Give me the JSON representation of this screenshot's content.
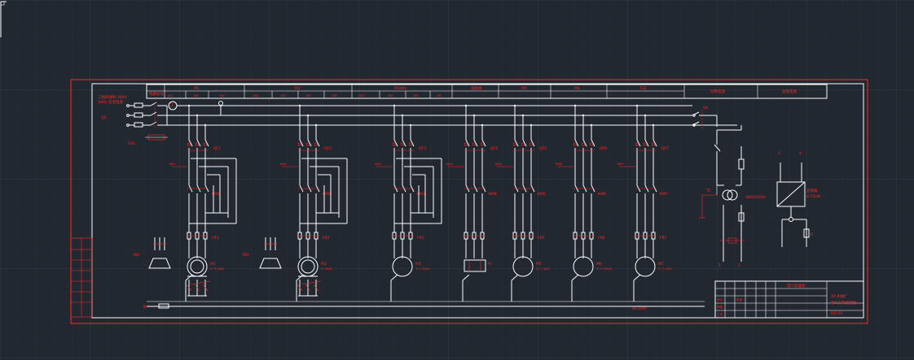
{
  "theme": {
    "background": "#212830",
    "grid_minor": "#2a323c",
    "grid_major": "#333c47",
    "frame_color": "#ff2a2a",
    "line_color": "#ffffff",
    "text_color": "#ff2a2a"
  },
  "header": {
    "left_cell": "线路标号",
    "cells": [
      "M1",
      "M2",
      "M3/M4",
      "电磁阀",
      "M5",
      "M6",
      "TS2"
    ],
    "sub_cells": [
      "QS1",
      "KM",
      "KM",
      "QS2",
      "KM",
      "KM",
      "KM",
      "QS3",
      "KM",
      "KM",
      "KM"
    ],
    "right_cells": [
      "控制电源",
      "变频电源"
    ]
  },
  "incoming": {
    "note_line1": "三相四线制 380V",
    "note_line2": "50Hz 交流电源",
    "phases": [
      "L1",
      "L2",
      "L3"
    ],
    "fuse_label": "FU1",
    "switch_label": "QS"
  },
  "columns": [
    {
      "id": "m1",
      "breaker": "QF1",
      "contactor": "KM1",
      "relay": "FR1",
      "motor": "M1",
      "motor_note": "3~5.5kW"
    },
    {
      "id": "m2",
      "breaker": "QF2",
      "contactor": "KM2",
      "relay": "FR2",
      "motor": "M2",
      "motor_note": "3~4kW"
    },
    {
      "id": "m3",
      "breaker": "QF3",
      "contactor": "KM3",
      "relay": "FR3",
      "motor": "M3",
      "motor_note": "3~2.2kW"
    },
    {
      "id": "valve",
      "breaker": "QF4",
      "contactor": "KM4",
      "relay": "",
      "motor": "YV",
      "motor_note": ""
    },
    {
      "id": "m5",
      "breaker": "QF5",
      "contactor": "KM5",
      "relay": "FR5",
      "motor": "M5",
      "motor_note": "3~1.5kW"
    },
    {
      "id": "m6",
      "breaker": "QF6",
      "contactor": "KM6",
      "relay": "FR6",
      "motor": "M6",
      "motor_note": "3~0.75kW"
    },
    {
      "id": "m7",
      "breaker": "QF7",
      "contactor": "KM7",
      "relay": "FR7",
      "motor": "M7",
      "motor_note": "3~1.1kW"
    }
  ],
  "side_labels": {
    "brake_1": "YB1",
    "brake_2": "YB2",
    "ground": "PE",
    "bus_label": "N",
    "bus_note": "AC220V"
  },
  "control": {
    "switch": "SA",
    "transformer": "TC",
    "transformer_note": "380V/220V",
    "inverter": "变频器",
    "inverter_note": "0.75kW",
    "resistor": "R",
    "terminals": [
      "1",
      "2",
      "3",
      "4"
    ]
  },
  "title_block": {
    "title": "电气原理图",
    "drawing_name": "电气控制原理图",
    "company": "XX 机械厂",
    "drawing_no": "DQ-01",
    "rows": [
      "设计",
      "审核",
      "工艺",
      "批准"
    ]
  }
}
